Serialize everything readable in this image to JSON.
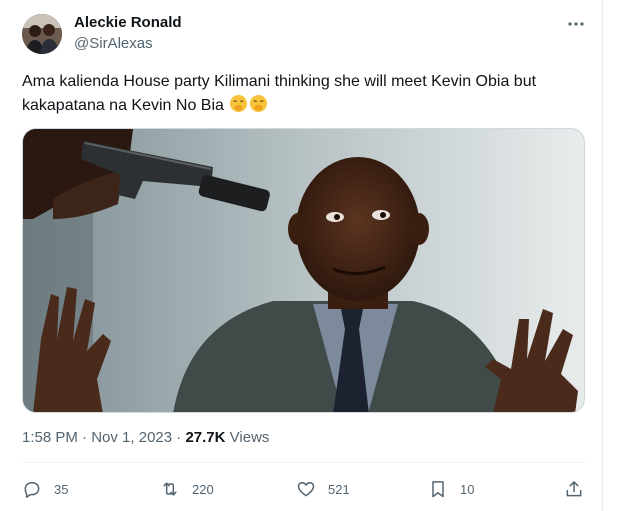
{
  "author": {
    "name": "Aleckie Ronald",
    "handle": "@SirAlexas"
  },
  "icons": {
    "more": "more-horizontal-icon",
    "reply": "reply-icon",
    "retweet": "retweet-icon",
    "like": "heart-icon",
    "bookmark": "bookmark-icon",
    "share": "share-icon",
    "emoji": "face-with-hand-over-mouth-emoji"
  },
  "tweet": {
    "text": "Ama kalienda House party Kilimani thinking she will meet Kevin Obia but kakapatana na Kevin No Bia",
    "emoji": "🤭🤭"
  },
  "meta": {
    "time": "1:58 PM",
    "separator": " · ",
    "date": "Nov 1, 2023",
    "views_count": "27.7K",
    "views_label": "Views"
  },
  "actions": {
    "replies": "35",
    "retweets": "220",
    "likes": "521",
    "bookmarks": "10"
  },
  "colors": {
    "text": "#0f1419",
    "secondary": "#536471",
    "border": "#cfd9de"
  }
}
